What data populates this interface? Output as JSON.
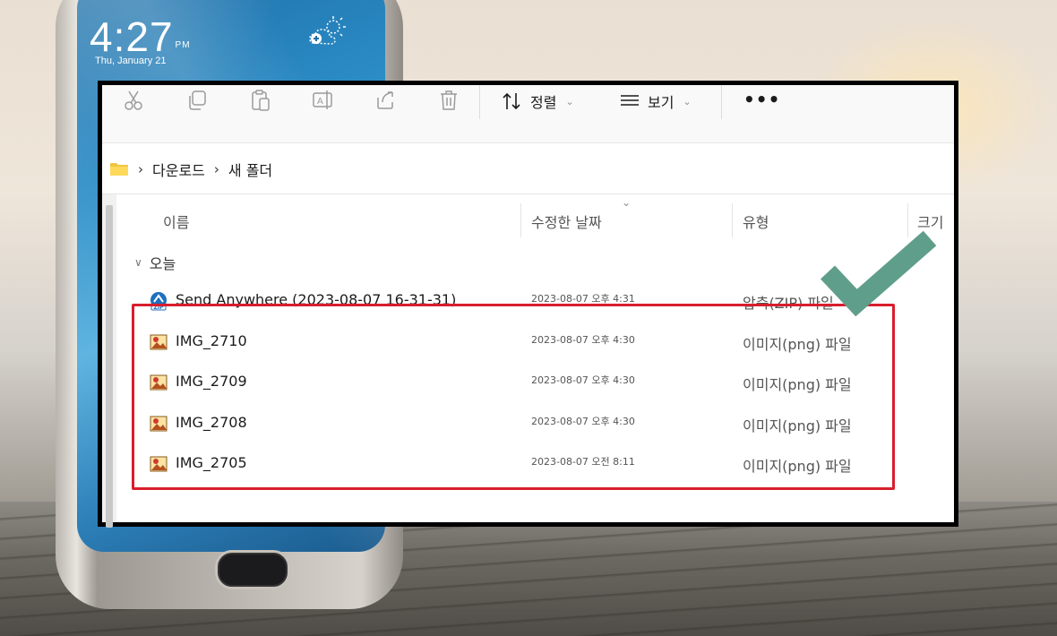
{
  "phone": {
    "time": "4:27",
    "ampm": "PM",
    "date": "Thu, January 21"
  },
  "toolbar": {
    "icons": [
      "cut-icon",
      "copy-icon",
      "paste-icon",
      "rename-icon",
      "share-icon",
      "delete-icon"
    ],
    "sort_label": "정렬",
    "view_label": "보기",
    "more_label": "•••"
  },
  "breadcrumb": {
    "items": [
      "다운로드",
      "새 폴더"
    ]
  },
  "columns": {
    "name": "이름",
    "modified": "수정한 날짜",
    "type": "유형",
    "size": "크기"
  },
  "group": {
    "label": "오늘"
  },
  "files": [
    {
      "name": "Send Anywhere (2023-08-07 16-31-31)",
      "modified": "2023-08-07 오후 4:31",
      "type": "압축(ZIP) 파일",
      "icon": "zip-icon"
    },
    {
      "name": "IMG_2710",
      "modified": "2023-08-07 오후 4:30",
      "type": "이미지(png) 파일",
      "icon": "image-icon"
    },
    {
      "name": "IMG_2709",
      "modified": "2023-08-07 오후 4:30",
      "type": "이미지(png) 파일",
      "icon": "image-icon"
    },
    {
      "name": "IMG_2708",
      "modified": "2023-08-07 오후 4:30",
      "type": "이미지(png) 파일",
      "icon": "image-icon"
    },
    {
      "name": "IMG_2705",
      "modified": "2023-08-07 오전 8:11",
      "type": "이미지(png) 파일",
      "icon": "image-icon"
    }
  ],
  "colors": {
    "highlight": "#d81e2c",
    "checkmark": "#5f9e8a"
  }
}
